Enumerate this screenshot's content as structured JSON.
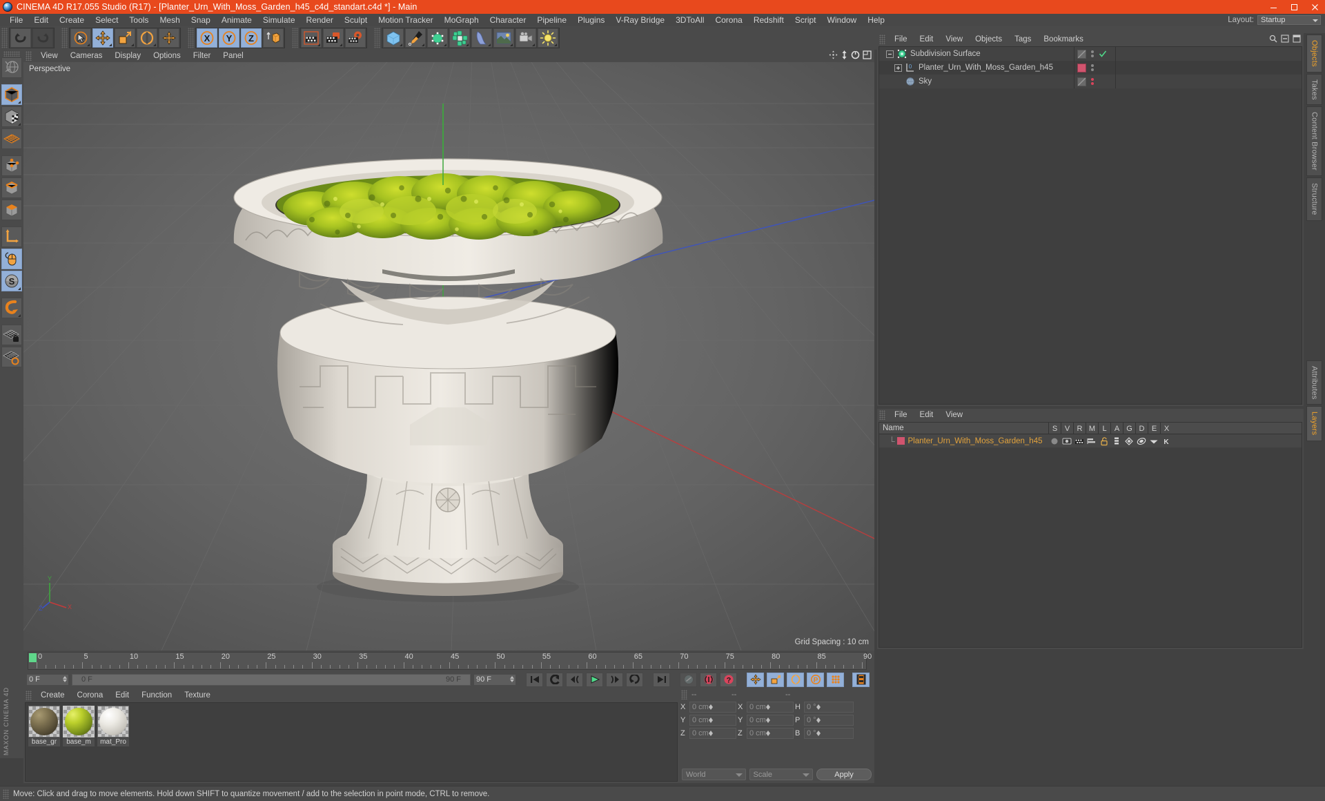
{
  "window": {
    "title": "CINEMA 4D R17.055 Studio (R17) - [Planter_Urn_With_Moss_Garden_h45_c4d_standart.c4d *] - Main",
    "minimize": "minimize-icon",
    "maximize": "maximize-icon",
    "close": "close-icon",
    "titlebar_color": "#e8491d"
  },
  "menubar": {
    "items": [
      "File",
      "Edit",
      "Create",
      "Select",
      "Tools",
      "Mesh",
      "Snap",
      "Animate",
      "Simulate",
      "Render",
      "Sculpt",
      "Motion Tracker",
      "MoGraph",
      "Character",
      "Pipeline",
      "Plugins",
      "V-Ray Bridge",
      "3DToAll",
      "Corona",
      "Redshift",
      "Script",
      "Window",
      "Help"
    ],
    "layout_label": "Layout:",
    "layout_value": "Startup"
  },
  "toolbar": {
    "groups": [
      {
        "name": "undo-redo",
        "buttons": [
          {
            "name": "undo-button",
            "icon": "undo-icon",
            "state": "normal"
          },
          {
            "name": "redo-button",
            "icon": "redo-icon",
            "state": "disabled"
          }
        ]
      },
      {
        "name": "transform-tools",
        "buttons": [
          {
            "name": "select-tool-button",
            "icon": "cursor-select-icon",
            "state": "normal"
          },
          {
            "name": "move-tool-button",
            "icon": "move-icon",
            "state": "active"
          },
          {
            "name": "scale-tool-button",
            "icon": "scale-icon",
            "state": "normal"
          },
          {
            "name": "rotate-tool-button",
            "icon": "rotate-icon",
            "state": "normal"
          },
          {
            "name": "move-axis-button",
            "icon": "move-axis-icon",
            "state": "normal"
          }
        ]
      },
      {
        "name": "axis-locks",
        "buttons": [
          {
            "name": "lock-x-button",
            "icon": "axis-x-icon",
            "state": "active",
            "label": "X"
          },
          {
            "name": "lock-y-button",
            "icon": "axis-y-icon",
            "state": "active",
            "label": "Y"
          },
          {
            "name": "lock-z-button",
            "icon": "axis-z-icon",
            "state": "active",
            "label": "Z"
          },
          {
            "name": "world-object-coord-button",
            "icon": "world-coord-icon",
            "state": "normal"
          }
        ]
      },
      {
        "name": "render-tools",
        "buttons": [
          {
            "name": "render-view-button",
            "icon": "render-view-icon",
            "state": "normal"
          },
          {
            "name": "render-to-picture-viewer-button",
            "icon": "render-picture-icon",
            "state": "normal"
          },
          {
            "name": "render-settings-button",
            "icon": "render-settings-icon",
            "state": "normal"
          }
        ]
      },
      {
        "name": "create-objects",
        "buttons": [
          {
            "name": "add-cube-button",
            "icon": "cube-icon",
            "state": "normal"
          },
          {
            "name": "add-spline-button",
            "icon": "pen-spline-icon",
            "state": "normal"
          },
          {
            "name": "add-generator-button",
            "icon": "generator-icon",
            "state": "normal"
          },
          {
            "name": "add-array-button",
            "icon": "array-icon",
            "state": "normal"
          },
          {
            "name": "add-deformer-button",
            "icon": "deformer-icon",
            "state": "normal"
          },
          {
            "name": "add-environment-button",
            "icon": "environment-icon",
            "state": "normal"
          },
          {
            "name": "add-camera-button",
            "icon": "camera-icon",
            "state": "normal"
          },
          {
            "name": "add-light-button",
            "icon": "light-icon",
            "state": "normal"
          }
        ]
      }
    ]
  },
  "left_toolbar": {
    "buttons": [
      {
        "name": "viewport-navigation-button",
        "icon": "globe-axis-icon",
        "state": "normal"
      },
      {
        "name": "model-mode-button",
        "icon": "model-cube-icon",
        "state": "active"
      },
      {
        "name": "texture-mode-button",
        "icon": "texture-cube-icon",
        "state": "normal"
      },
      {
        "name": "polygon-grid-button",
        "icon": "poly-grid-icon",
        "state": "normal"
      },
      {
        "name": "points-mode-button",
        "icon": "points-cube-icon",
        "state": "normal"
      },
      {
        "name": "edges-mode-button",
        "icon": "edges-cube-icon",
        "state": "normal"
      },
      {
        "name": "polygons-mode-button",
        "icon": "polygons-cube-icon",
        "state": "normal"
      },
      {
        "name": "axis-mode-button",
        "icon": "axis-l-icon",
        "state": "normal"
      },
      {
        "name": "viewport-solo-button",
        "icon": "mouse-icon",
        "state": "active"
      },
      {
        "name": "snap-settings-button",
        "icon": "s-compass-icon",
        "state": "active"
      },
      {
        "name": "magnet-button",
        "icon": "magnet-icon",
        "state": "normal"
      },
      {
        "name": "lock-workplane-button",
        "icon": "grid-lock-icon",
        "state": "normal"
      },
      {
        "name": "workplane-button",
        "icon": "grid-orange-icon",
        "state": "normal"
      }
    ],
    "brand": "MAXON CINEMA 4D"
  },
  "viewport": {
    "menu": [
      "View",
      "Cameras",
      "Display",
      "Options",
      "Filter",
      "Panel"
    ],
    "label": "Perspective",
    "grid_spacing": "Grid Spacing : 10 cm",
    "axis_labels": {
      "y": "Y",
      "x": "X",
      "z": "Z"
    },
    "icons": [
      "move-view-icon",
      "pan-view-icon",
      "rotate-view-icon",
      "maximize-view-icon"
    ]
  },
  "timeline": {
    "ticks": [
      0,
      5,
      10,
      15,
      20,
      25,
      30,
      35,
      40,
      45,
      50,
      55,
      60,
      65,
      70,
      75,
      80,
      85,
      90
    ],
    "current_frame": "0 F",
    "range_start": "0 F",
    "range_end": "90 F",
    "end_frame": "90 F",
    "preview_end": "0 F",
    "playback_buttons": [
      {
        "name": "goto-start-button",
        "icon": "skip-start-icon"
      },
      {
        "name": "step-back-keyframe-button",
        "icon": "prev-keyframe-icon"
      },
      {
        "name": "step-back-frame-button",
        "icon": "prev-frame-icon"
      },
      {
        "name": "play-button",
        "icon": "play-icon"
      },
      {
        "name": "step-forward-frame-button",
        "icon": "next-frame-icon"
      },
      {
        "name": "loop-button",
        "icon": "loop-icon"
      },
      {
        "name": "goto-end-button",
        "icon": "skip-end-icon"
      }
    ],
    "record_buttons": [
      {
        "name": "record-active-objects-button",
        "icon": "key-record-icon",
        "state": "disabled"
      },
      {
        "name": "autokeying-button",
        "icon": "autokey-icon",
        "state": "normal"
      },
      {
        "name": "keyframe-selection-button",
        "icon": "keyframe-select-icon",
        "state": "normal"
      }
    ],
    "key_toggles": [
      {
        "name": "position-key-button",
        "icon": "move-key-icon",
        "state": "active"
      },
      {
        "name": "scale-key-button",
        "icon": "scale-key-icon",
        "state": "active"
      },
      {
        "name": "rotation-key-button",
        "icon": "rotate-key-icon",
        "state": "active"
      },
      {
        "name": "parameter-key-button",
        "icon": "param-key-icon",
        "state": "active"
      },
      {
        "name": "pla-key-button",
        "icon": "pla-key-icon",
        "state": "active"
      },
      {
        "name": "timeline-view-button",
        "icon": "timeline-film-icon",
        "state": "active"
      }
    ]
  },
  "material_manager": {
    "menu": [
      "Create",
      "Corona",
      "Edit",
      "Function",
      "Texture"
    ],
    "materials": [
      {
        "name": "base_gr",
        "color": "#6d6147",
        "selected": false
      },
      {
        "name": "base_m",
        "color": "#b6c631",
        "selected": true
      },
      {
        "name": "mat_Pro",
        "color": "#d8d8d4",
        "selected": false
      }
    ]
  },
  "coordinates_manager": {
    "header_cols": [
      "--",
      "--",
      "--"
    ],
    "rows": [
      {
        "label1": "X",
        "value1": "0 cm",
        "label2": "X",
        "value2": "0 cm",
        "label3": "H",
        "value3": "0 °"
      },
      {
        "label1": "Y",
        "value1": "0 cm",
        "label2": "Y",
        "value2": "0 cm",
        "label3": "P",
        "value3": "0 °"
      },
      {
        "label1": "Z",
        "value1": "0 cm",
        "label2": "Z",
        "value2": "0 cm",
        "label3": "B",
        "value3": "0 °"
      }
    ],
    "system": "World",
    "mode": "Scale",
    "apply": "Apply"
  },
  "object_manager": {
    "menu": [
      "File",
      "Edit",
      "View",
      "Objects",
      "Tags",
      "Bookmarks"
    ],
    "items": [
      {
        "name": "Subdivision Surface",
        "icon": "subdivision-surface-icon",
        "depth": 0,
        "expander": "minus",
        "tag_color": "#7a7a7a",
        "check": true,
        "dots": "gray"
      },
      {
        "name": "Planter_Urn_With_Moss_Garden_h45",
        "icon": "null-object-icon",
        "depth": 1,
        "expander": "plus",
        "tag_color": "#d1546e",
        "check": false,
        "dots": "gray"
      },
      {
        "name": "Sky",
        "icon": "sky-icon",
        "depth": 1,
        "expander": "none",
        "tag_color": "#7a7a7a",
        "check": false,
        "dots": "red"
      }
    ]
  },
  "layer_manager": {
    "menu": [
      "File",
      "Edit",
      "View"
    ],
    "columns": [
      "Name",
      "S",
      "V",
      "R",
      "M",
      "L",
      "A",
      "G",
      "D",
      "E",
      "X"
    ],
    "rows": [
      {
        "name": "Planter_Urn_With_Moss_Garden_h45",
        "swatch": "#d1546e"
      }
    ]
  },
  "right_tabs": {
    "upper": [
      {
        "label": "Objects",
        "active": true
      },
      {
        "label": "Takes",
        "active": false
      },
      {
        "label": "Content Browser",
        "active": false
      },
      {
        "label": "Structure",
        "active": false
      }
    ],
    "lower": [
      {
        "label": "Attributes",
        "active": false
      },
      {
        "label": "Layers",
        "active": true
      }
    ]
  },
  "statusbar": {
    "text": "Move: Click and drag to move elements. Hold down SHIFT to quantize movement / add to the selection in point mode, CTRL to remove."
  },
  "colors": {
    "accent_orange": "#e8491d",
    "panel_bg": "#4a4a4a",
    "field_bg": "#3f3f3f",
    "active_blue": "#93b0d8",
    "highlight_orange": "#f0a32a"
  }
}
